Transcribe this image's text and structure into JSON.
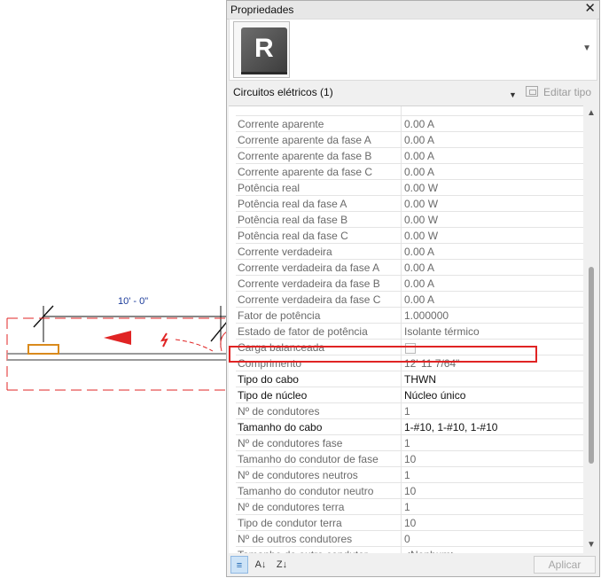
{
  "canvas": {
    "dimension_label": "10' - 0\"",
    "colors": {
      "dimension": "#1a3a9a",
      "circuit": "#e02424",
      "device": "#d98a1c",
      "conduit": "#9a9a9a"
    }
  },
  "palette": {
    "title": "Propriedades",
    "close_symbol": "✕",
    "type_icon": "revit-logo-icon",
    "type_logo_letter": "R",
    "filter": {
      "label": "Circuitos elétricos (1)"
    },
    "edit_type_label": "Editar tipo",
    "apply_label": "Aplicar",
    "highlight_color": "#e02424",
    "properties": [
      {
        "label": "Corrente aparente",
        "value": "0.00 A"
      },
      {
        "label": "Corrente aparente da fase A",
        "value": "0.00 A"
      },
      {
        "label": "Corrente aparente da fase B",
        "value": "0.00 A"
      },
      {
        "label": "Corrente aparente da fase C",
        "value": "0.00 A"
      },
      {
        "label": "Potência real",
        "value": "0.00 W"
      },
      {
        "label": "Potência real da fase A",
        "value": "0.00 W"
      },
      {
        "label": "Potência real da fase B",
        "value": "0.00 W"
      },
      {
        "label": "Potência real da fase C",
        "value": "0.00 W"
      },
      {
        "label": "Corrente verdadeira",
        "value": "0.00 A"
      },
      {
        "label": "Corrente verdadeira da fase A",
        "value": "0.00 A"
      },
      {
        "label": "Corrente verdadeira da fase B",
        "value": "0.00 A"
      },
      {
        "label": "Corrente verdadeira da fase C",
        "value": "0.00 A"
      },
      {
        "label": "Fator de potência",
        "value": "1.000000"
      },
      {
        "label": "Estado de fator de potência",
        "value": "Isolante térmico"
      },
      {
        "label": "Carga balanceada",
        "value": ""
      },
      {
        "label": "Comprimento",
        "value": "12'  11 7/64\""
      },
      {
        "label": "Tipo do cabo",
        "value": "THWN"
      },
      {
        "label": "Tipo de núcleo",
        "value": "Núcleo único"
      },
      {
        "label": "Nº de condutores",
        "value": "1"
      },
      {
        "label": "Tamanho do cabo",
        "value": "1-#10, 1-#10, 1-#10"
      },
      {
        "label": "Nº de condutores fase",
        "value": "1"
      },
      {
        "label": "Tamanho do condutor de fase",
        "value": "10"
      },
      {
        "label": "Nº de condutores neutros",
        "value": "1"
      },
      {
        "label": "Tamanho do condutor neutro",
        "value": "10"
      },
      {
        "label": "Nº de condutores terra",
        "value": "1"
      },
      {
        "label": "Tipo de condutor terra",
        "value": "10"
      },
      {
        "label": "Nº de outros condutores",
        "value": "0"
      },
      {
        "label": "Tamanho do outro condutor",
        "value": "<Nenhum>"
      }
    ]
  }
}
